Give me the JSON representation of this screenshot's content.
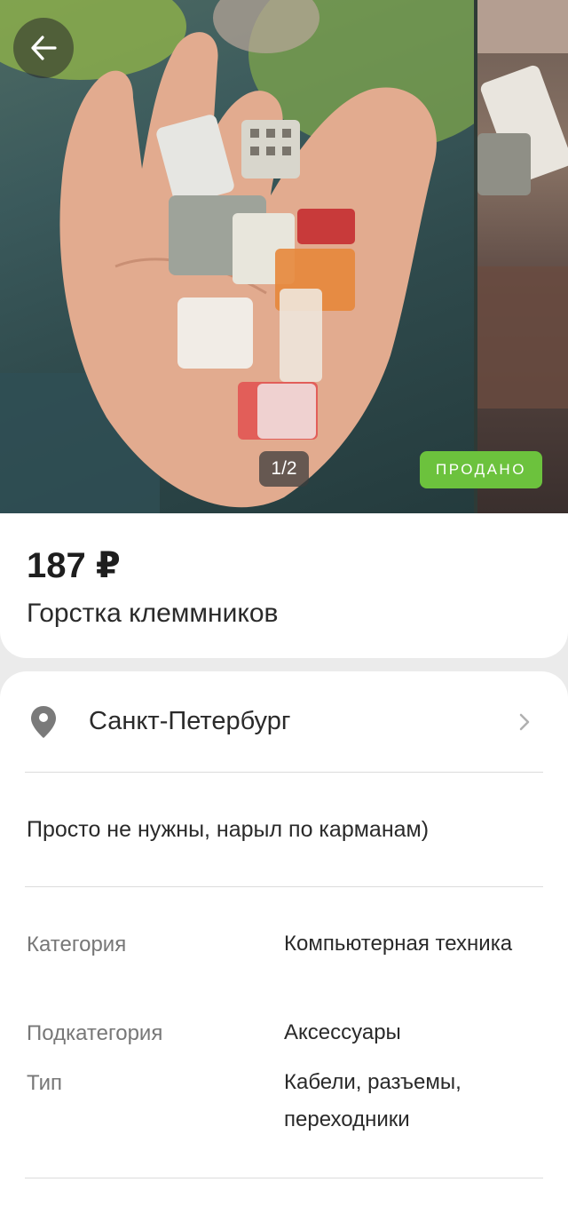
{
  "gallery": {
    "counter": "1/2",
    "sold_badge": "ПРОДАНО"
  },
  "listing": {
    "price": "187 ₽",
    "title": "Горстка клеммников"
  },
  "location": {
    "city": "Санкт-Петербург"
  },
  "description": "Просто не нужны, нарыл по карманам)",
  "attributes": [
    {
      "label": "Категория",
      "value": "Компьютерная техника"
    },
    {
      "label": "Подкатегория",
      "value": "Аксессуары"
    },
    {
      "label": "Тип",
      "value": "Кабели, разъемы, переходники"
    }
  ],
  "colors": {
    "sold": "#6cc23d"
  }
}
